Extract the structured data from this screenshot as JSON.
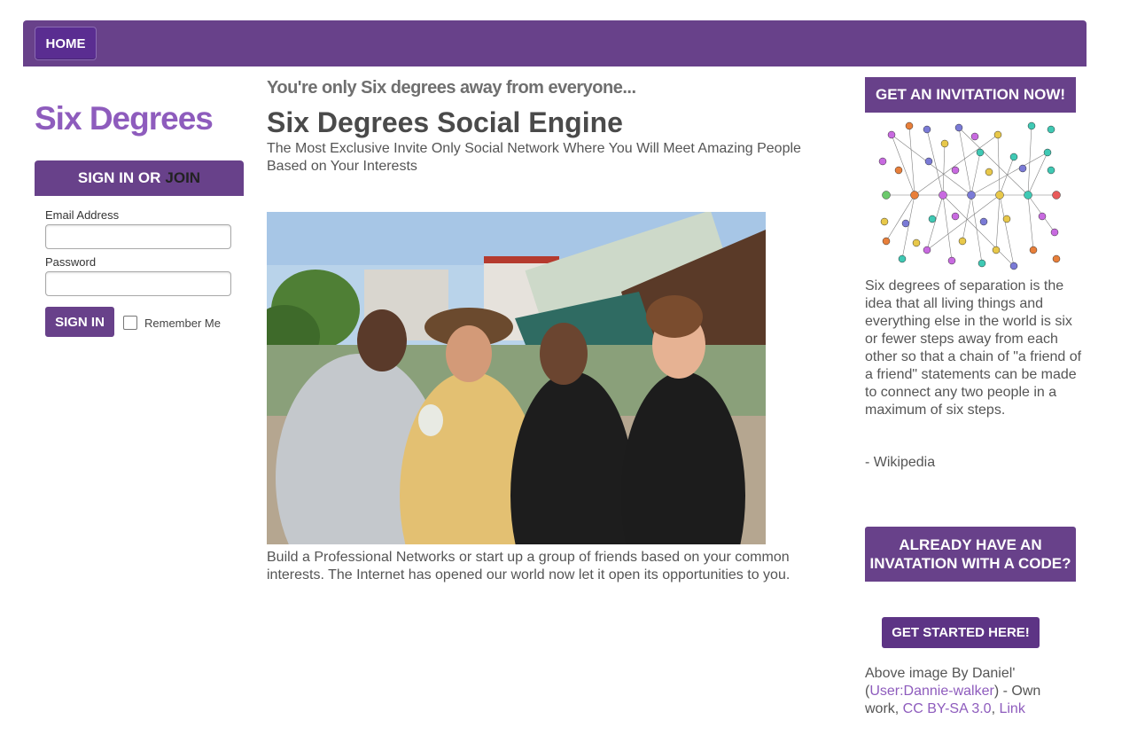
{
  "nav": {
    "home_label": "HOME"
  },
  "brand": {
    "name": "Six Degrees"
  },
  "signin": {
    "heading": "SIGN IN OR",
    "join_label": "JOIN",
    "email_label": "Email Address",
    "email_value": "",
    "password_label": "Password",
    "password_value": "",
    "button_label": "SIGN IN",
    "remember_label": "Remember Me"
  },
  "main": {
    "tagline": "You're only Six degrees away from everyone...",
    "title": "Six Degrees Social Engine",
    "subtitle": "The Most Exclusive Invite Only Social Network Where You Will Meet Amazing People Based on Your Interests",
    "body": "Build a Professional Networks or start up a group of friends based on your common interests. The Internet has opened our world now let it open its opportunities to you."
  },
  "sidebar": {
    "invite_heading": "GET AN INVITATION NOW!",
    "description": "Six degrees of separation is the idea that all living things and everything else in the world is six or fewer steps away from each other so that a chain of \"a friend of a friend\" statements can be made to connect any two people in a maximum of six steps.",
    "attribution": " - Wikipedia",
    "code_heading": "ALREADY HAVE AN INVATATION WITH A CODE?",
    "started_label": "GET STARTED HERE!",
    "credit": {
      "prefix": "Above image By Daniel' (",
      "user_link": "User:Dannie-walker",
      "middle": ") - Own work, ",
      "license_link": "CC BY-SA 3.0",
      "sep": ", ",
      "link_label": "Link"
    }
  },
  "colors": {
    "primary": "#68418a",
    "brand": "#8e5cbd",
    "link": "#8e5cbd"
  }
}
